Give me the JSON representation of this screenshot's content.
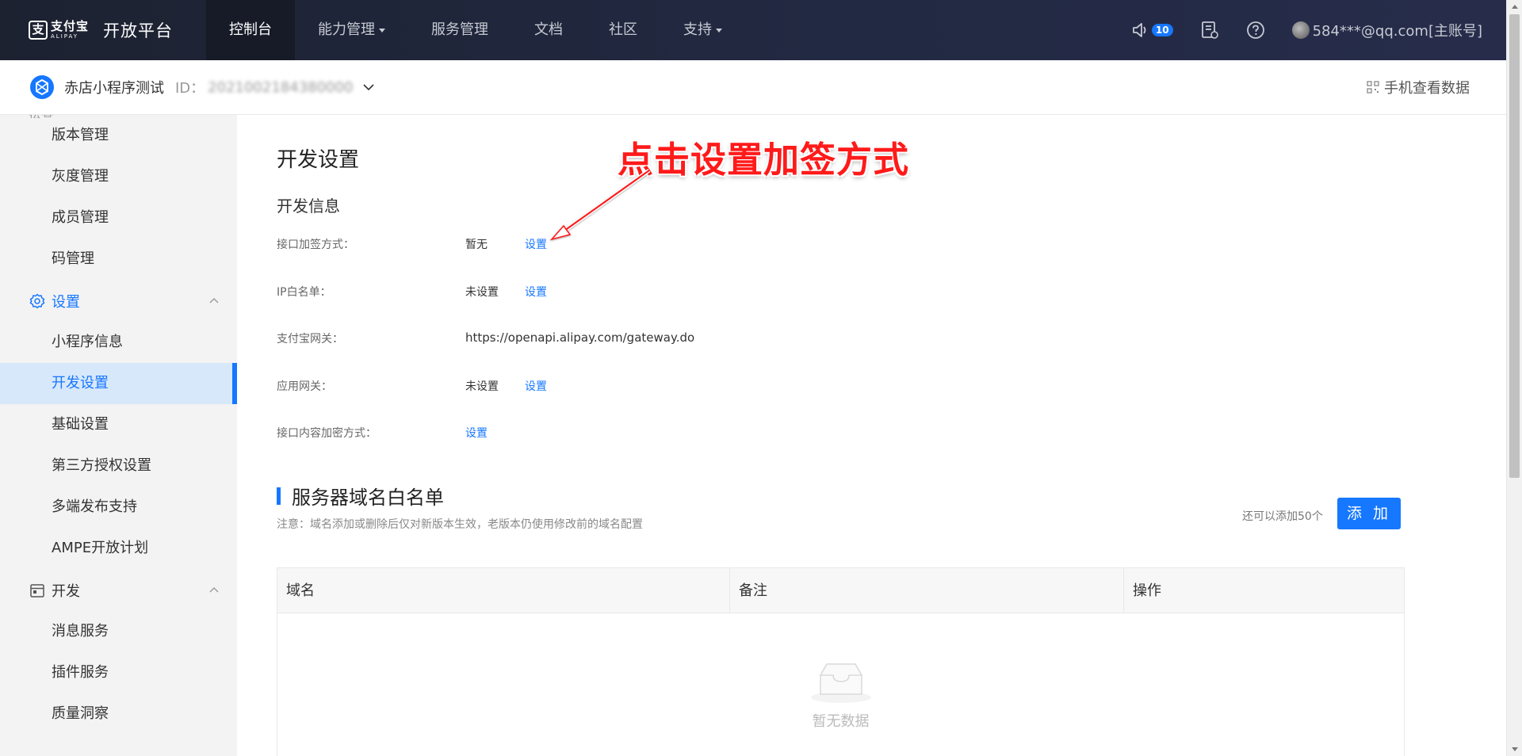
{
  "topnav": {
    "logo_cn": "支付宝",
    "logo_en": "ALIPAY",
    "platform": "开放平台",
    "items": [
      {
        "label": "控制台"
      },
      {
        "label": "能力管理"
      },
      {
        "label": "服务管理"
      },
      {
        "label": "文档"
      },
      {
        "label": "社区"
      },
      {
        "label": "支持"
      }
    ],
    "notification_count": "10",
    "user": "584***@qq.com[主账号]"
  },
  "subheader": {
    "app_name": "赤店小程序测试",
    "id_label": "ID：",
    "id_value": "2021002184380000",
    "mobile_view": "手机查看数据"
  },
  "sidebar": {
    "cut_label": "运营",
    "items_top": [
      "版本管理",
      "灰度管理",
      "成员管理",
      "码管理"
    ],
    "group_settings": "设置",
    "settings_items": [
      "小程序信息",
      "开发设置",
      "基础设置",
      "第三方授权设置",
      "多端发布支持",
      "AMPE开放计划"
    ],
    "group_dev": "开发",
    "dev_items": [
      "消息服务",
      "插件服务",
      "质量洞察"
    ]
  },
  "main": {
    "title": "开发设置",
    "annotation": "点击设置加签方式",
    "section_title": "开发信息",
    "rows": [
      {
        "label": "接口加签方式：",
        "value": "暂无",
        "link": "设置"
      },
      {
        "label": "IP白名单：",
        "value": "未设置",
        "link": "设置"
      },
      {
        "label": "支付宝网关：",
        "value": "https://openapi.alipay.com/gateway.do",
        "link": ""
      },
      {
        "label": "应用网关：",
        "value": "未设置",
        "link": "设置"
      },
      {
        "label": "接口内容加密方式：",
        "value": "",
        "link": "设置"
      }
    ],
    "domain_title": "服务器域名白名单",
    "domain_note": "注意：域名添加或删除后仅对新版本生效，老版本仍使用修改前的域名配置",
    "remaining": "还可以添加50个",
    "add_button": "添 加",
    "table_headers": [
      "域名",
      "备注",
      "操作"
    ],
    "empty_text": "暂无数据"
  },
  "colors": {
    "accent": "#1677ff",
    "nav_bg": "#222942",
    "annotation": "#ff1a1a"
  }
}
